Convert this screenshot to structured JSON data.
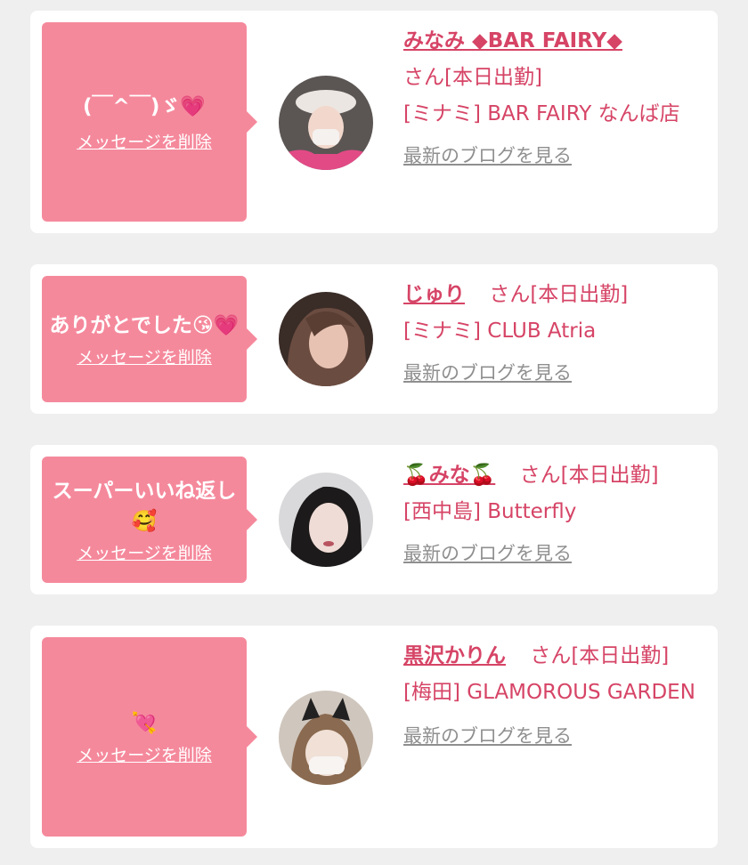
{
  "messages": [
    {
      "message": "(￣^￣)ゞ💗",
      "delete_label": "メッセージを削除",
      "name": "みなみ ◆BAR FAIRY◆",
      "san": "さん[本日出勤]",
      "shop": "[ミナミ] BAR FAIRY なんば店",
      "blog_label": "最新のブログを見る"
    },
    {
      "message": "ありがとでした😘💗",
      "delete_label": "メッセージを削除",
      "name": "じゅり",
      "san": "さん[本日出勤]",
      "shop": "[ミナミ] CLUB Atria",
      "blog_label": "最新のブログを見る"
    },
    {
      "message": "スーパーいいね返し🥰",
      "delete_label": "メッセージを削除",
      "name": "🍒みな🍒",
      "san": "さん[本日出勤]",
      "shop": "[西中島] Butterfly",
      "blog_label": "最新のブログを見る"
    },
    {
      "message": "💘",
      "delete_label": "メッセージを削除",
      "name": "黒沢かりん",
      "san": "さん[本日出勤]",
      "shop": "[梅田] GLAMOROUS GARDEN",
      "blog_label": "最新のブログを見る"
    }
  ],
  "colors": {
    "bubble": "#f5899c",
    "name": "#d64466",
    "link_gray": "#8f8f8f",
    "background": "#efefef"
  }
}
